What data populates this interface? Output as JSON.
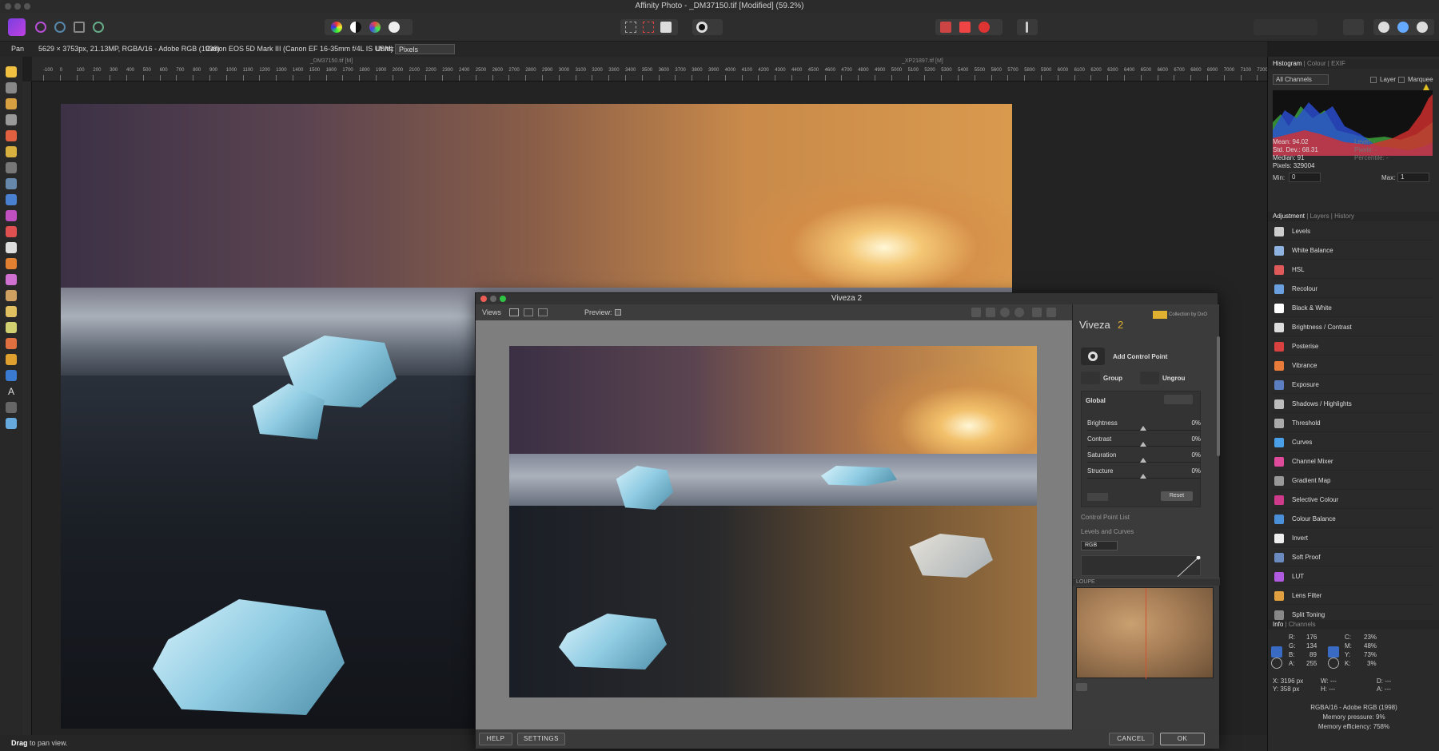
{
  "app": {
    "window_title": "Affinity Photo - _DM37150.tif [Modified] (59.2%)"
  },
  "context_bar": {
    "tool": "Pan",
    "doc_info": "5629 × 3753px, 21.13MP, RGBA/16 - Adobe RGB (1998)",
    "camera": "Canon EOS 5D Mark III (Canon EF 16-35mm f/4L IS USM)",
    "units_label": "Units:",
    "units_value": "Pixels"
  },
  "doc_tabs": [
    "_DM37150.tif [M]",
    "_XP21897.tif [M]"
  ],
  "ruler_ticks": [
    "-100",
    "0",
    "100",
    "200",
    "300",
    "400",
    "500",
    "600",
    "700",
    "800",
    "900",
    "1000",
    "1100",
    "1200",
    "1300",
    "1400",
    "1500",
    "1600",
    "1700",
    "1800",
    "1900",
    "2000",
    "2100",
    "2200",
    "2300",
    "2400",
    "2500",
    "2600",
    "2700",
    "2800",
    "2900",
    "3000",
    "3100",
    "3200",
    "3300",
    "3400",
    "3500",
    "3600",
    "3700",
    "3800",
    "3900",
    "4000",
    "4100",
    "4200",
    "4300",
    "4400",
    "4500",
    "4600",
    "4700",
    "4800",
    "4900",
    "5000",
    "5100",
    "5200",
    "5300",
    "5400",
    "5500",
    "5600",
    "5700",
    "5800",
    "5900",
    "6000",
    "6100",
    "6200",
    "6300",
    "6400",
    "6500",
    "6600",
    "6700",
    "6800",
    "6900",
    "7000",
    "7100",
    "7200"
  ],
  "status": {
    "bold": "Drag",
    "text": "to pan view."
  },
  "panel_histogram": {
    "tabs": [
      "Histogram",
      "Colour",
      "EXIF"
    ],
    "channel": "All Channels",
    "layer_label": "Layer",
    "marquee_label": "Marquee",
    "stats": {
      "mean": "Mean: 94.02",
      "std": "Std. Dev.: 68.31",
      "median": "Median: 91",
      "pixels": "Pixels: 329004",
      "level": "Level: -",
      "pixels_r": "Pixels: -",
      "percentile": "Percentile: -"
    },
    "min_label": "Min:",
    "min_value": "0",
    "max_label": "Max:",
    "max_value": "1"
  },
  "panel_adjust": {
    "tabs": [
      "Adjustment",
      "Layers",
      "History"
    ],
    "items": [
      {
        "label": "Levels",
        "color": "#cccccc"
      },
      {
        "label": "White Balance",
        "color": "#8fb3e0"
      },
      {
        "label": "HSL",
        "color": "#e05a5a"
      },
      {
        "label": "Recolour",
        "color": "#6a9fe0"
      },
      {
        "label": "Black & White",
        "color": "#ffffff"
      },
      {
        "label": "Brightness / Contrast",
        "color": "#dddddd"
      },
      {
        "label": "Posterise",
        "color": "#d94040"
      },
      {
        "label": "Vibrance",
        "color": "#e87a3a"
      },
      {
        "label": "Exposure",
        "color": "#5b7fc0"
      },
      {
        "label": "Shadows / Highlights",
        "color": "#bbbbbb"
      },
      {
        "label": "Threshold",
        "color": "#aaaaaa"
      },
      {
        "label": "Curves",
        "color": "#4aa0e8"
      },
      {
        "label": "Channel Mixer",
        "color": "#e04a9a"
      },
      {
        "label": "Gradient Map",
        "color": "#999999"
      },
      {
        "label": "Selective Colour",
        "color": "#d03a8a"
      },
      {
        "label": "Colour Balance",
        "color": "#4a90d9"
      },
      {
        "label": "Invert",
        "color": "#eeeeee"
      },
      {
        "label": "Soft Proof",
        "color": "#6a8ac0"
      },
      {
        "label": "LUT",
        "color": "#b05ae0"
      },
      {
        "label": "Lens Filter",
        "color": "#e0a040"
      },
      {
        "label": "Split Toning",
        "color": "#888888"
      }
    ]
  },
  "panel_info": {
    "tabs": [
      "Info",
      "Channels"
    ],
    "r": "R:",
    "r_val": "176",
    "g": "G:",
    "g_val": "134",
    "b": "B:",
    "b_val": "89",
    "a": "A:",
    "a_val": "255",
    "c": "C:",
    "c_val": "23%",
    "m": "M:",
    "m_val": "48%",
    "y": "Y:",
    "y_val": "73%",
    "k": "K:",
    "k_val": "3%",
    "x_pos": "X: 3196 px",
    "y_pos": "Y: 358 px",
    "w": "W: ---",
    "h": "H: ---",
    "d": "D: ---",
    "ang": "A: ---",
    "profile": "RGBA/16 - Adobe RGB (1998)",
    "mem_pressure": "Memory pressure: 9%",
    "mem_eff": "Memory efficiency: 758%"
  },
  "viveza": {
    "title": "Viveza 2",
    "views_label": "Views",
    "preview_label": "Preview:",
    "logo_text": "Viveza",
    "logo_num": "2",
    "collection": "Collection by DxO",
    "add_cp": "Add Control Point",
    "group": "Group",
    "ungroup": "Ungrou",
    "global": "Global",
    "sliders": [
      {
        "label": "Brightness",
        "value": "0%"
      },
      {
        "label": "Contrast",
        "value": "0%"
      },
      {
        "label": "Saturation",
        "value": "0%"
      },
      {
        "label": "Structure",
        "value": "0%"
      }
    ],
    "reset": "Reset",
    "cp_list": "Control Point List",
    "levels_curves": "Levels and Curves",
    "rgb": "RGB",
    "loupe": "LOUPE",
    "help": "HELP",
    "settings": "SETTINGS",
    "cancel": "CANCEL",
    "ok": "OK"
  }
}
